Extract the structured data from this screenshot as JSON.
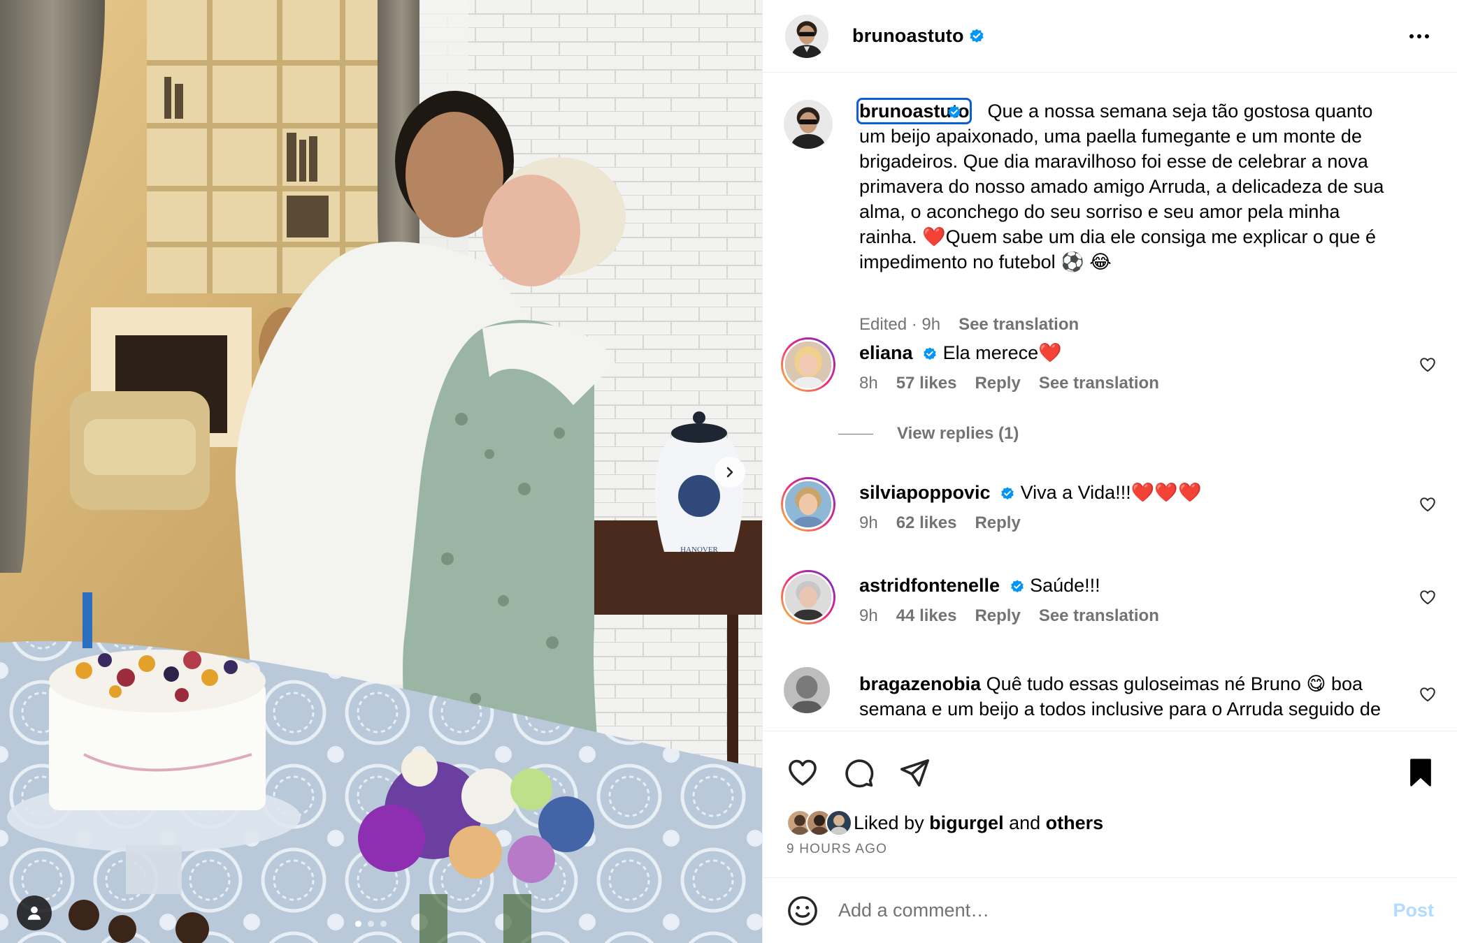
{
  "post": {
    "author": "bruno­astuto",
    "caption_user": "brunoastuto",
    "caption_text": "Que a nossa semana seja tão gostosa quanto um beijo apaixonado, uma paella fumegante e um monte de brigadeiros. Que dia maravilhoso foi esse de celebrar a nova primavera do nosso amado amigo Arruda, a delicadeza de sua alma, o aconchego do seu sorriso e seu amor pela minha rainha. ❤️Quem sabe um dia ele consiga me explicar o que é impedimento no futebol ⚽ 😂",
    "caption_meta": "Edited · 9h",
    "see_translation": "See translation",
    "photo_text": "HANOVER"
  },
  "comments": [
    {
      "user": "eliana",
      "text": "Ela merece❤️",
      "time": "8h",
      "likes": "57 likes",
      "reply": "Reply",
      "translation": "See translation",
      "view_replies": "View replies (1)"
    },
    {
      "user": "silviapoppovic",
      "text": "Viva a Vida!!!❤️❤️❤️",
      "time": "9h",
      "likes": "62 likes",
      "reply": "Reply"
    },
    {
      "user": "astridfontenelle",
      "text": "Saúde!!!",
      "time": "9h",
      "likes": "44 likes",
      "reply": "Reply",
      "translation": "See translation"
    },
    {
      "user": "bragazenobia",
      "text": "Quê tudo essas guloseimas né Bruno 😋 boa semana e um beijo a todos inclusive para o Arruda seguido de felicidades e um viva a vida🎉👏👏👏"
    }
  ],
  "likes": {
    "prefix": "Liked by ",
    "user": "bigurgel",
    "and": " and ",
    "others": "others",
    "time_ago": "9 HOURS AGO"
  },
  "composer": {
    "placeholder": "Add a comment…",
    "post_label": "Post"
  },
  "icons": {
    "header_more": "more-options-icon",
    "verified": "verified-badge-icon",
    "actions": [
      "heart-icon",
      "comment-icon",
      "share-icon",
      "bookmark-icon"
    ],
    "emoji": "emoji-icon",
    "carousel_next": "chevron-right-icon",
    "tag": "user-tag-icon"
  },
  "colors": {
    "verified": "#0095f6",
    "link_blue": "#b3dbff",
    "muted": "#737373"
  }
}
